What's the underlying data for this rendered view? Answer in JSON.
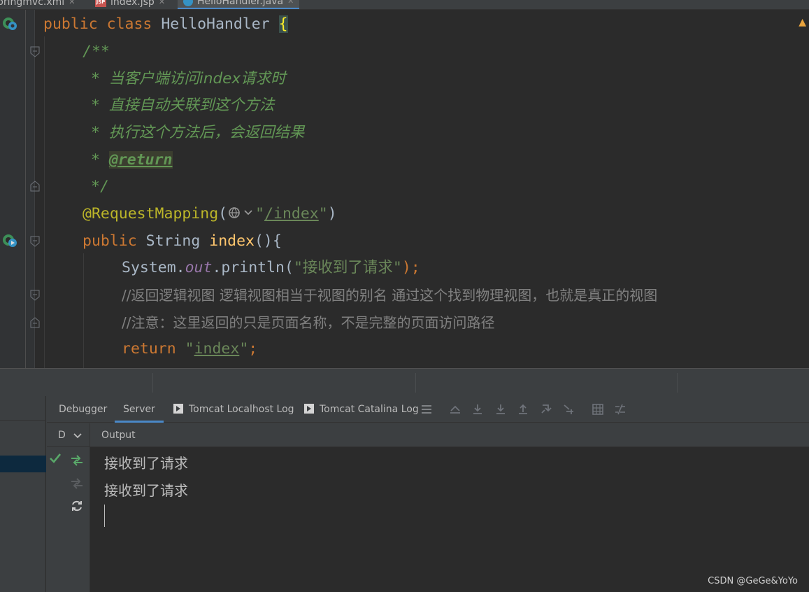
{
  "editor_tabs": [
    {
      "label": "pringmvc.xml",
      "icon": "xml-file-icon"
    },
    {
      "label": "index.jsp",
      "icon": "jsp-file-icon"
    },
    {
      "label": "HelloHandler.java",
      "icon": "java-class-icon",
      "active": true
    }
  ],
  "code": {
    "l1": {
      "kw1": "public",
      "kw2": "class",
      "name": "HelloHandler",
      "brace": "{"
    },
    "l2": "/**",
    "l3": "当客户端访问index请求时",
    "l4": "直接自动关联到这个方法",
    "l5": "执行这个方法后，会返回结果",
    "l6_tag": "@return",
    "l7": "*/",
    "l8": {
      "annotation": "@RequestMapping",
      "open": "(",
      "q1": "\"",
      "path": "/index",
      "q2": "\"",
      "close": ")"
    },
    "l9": {
      "kw": "public",
      "type": "String",
      "method": "index",
      "rest": "(){"
    },
    "l10": {
      "obj": "System.",
      "field": "out",
      "call": ".println(",
      "arg": "\"接收到了请求\"",
      "end": ");"
    },
    "l11": "//返回逻辑视图 逻辑视图相当于视图的别名 通过这个找到物理视图，也就是真正的视图",
    "l12": "//注意：这里返回的只是页面名称，不是完整的页面访问路径",
    "l13": {
      "kw": "return",
      "q1": "\"",
      "value": "index",
      "q2": "\"",
      "end": ";"
    }
  },
  "tool_tabs": {
    "debugger": "Debugger",
    "server": "Server",
    "localhost_log": "Tomcat Localhost Log",
    "catalina_log": "Tomcat Catalina Log"
  },
  "subbar": {
    "d": "D",
    "output": "Output"
  },
  "console_lines": [
    "接收到了请求",
    "接收到了请求"
  ],
  "watermark": "CSDN @GeGe&YoYo",
  "colors": {
    "keyword": "#cc7832",
    "string": "#6a8759",
    "doc": "#629755",
    "annotation": "#bbb529",
    "accent": "#4a88c7"
  }
}
